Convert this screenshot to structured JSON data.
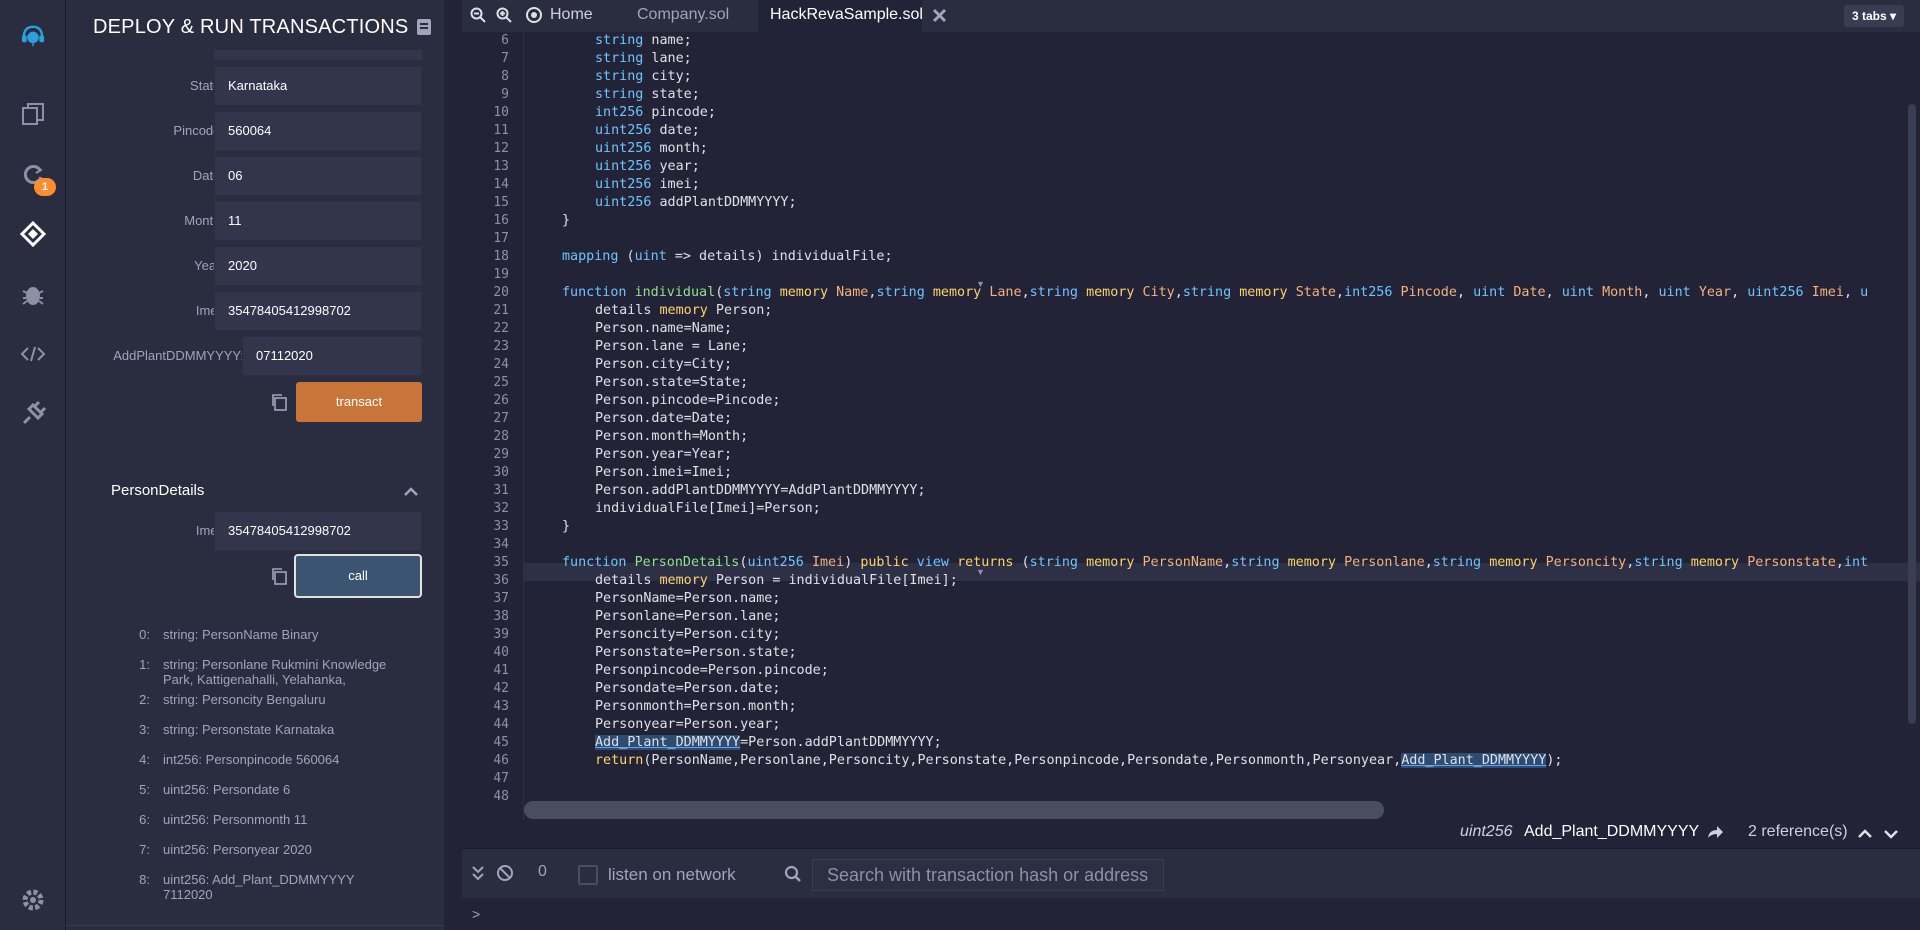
{
  "panel": {
    "title": "DEPLOY & RUN TRANSACTIONS",
    "fields": [
      {
        "label": "State:",
        "value": "Karnataka"
      },
      {
        "label": "Pincode:",
        "value": "560064"
      },
      {
        "label": "Date:",
        "value": "06"
      },
      {
        "label": "Month:",
        "value": "11"
      },
      {
        "label": "Year:",
        "value": "2020"
      },
      {
        "label": "Imei:",
        "value": "35478405412998702"
      },
      {
        "label": "AddPlantDDMMYYYY:",
        "value": "07112020"
      }
    ],
    "transact_label": "transact",
    "function_title": "PersonDetails",
    "call_field": {
      "label": "Imei:",
      "value": "35478405412998702"
    },
    "call_label": "call",
    "outputs": [
      {
        "idx": "0:",
        "val": "string: PersonName Binary"
      },
      {
        "idx": "1:",
        "val": "string: Personlane Rukmini Knowledge Park, Kattigenahalli, Yelahanka,"
      },
      {
        "idx": "2:",
        "val": "string: Personcity Bengaluru"
      },
      {
        "idx": "3:",
        "val": "string: Personstate Karnataka"
      },
      {
        "idx": "4:",
        "val": "int256: Personpincode 560064"
      },
      {
        "idx": "5:",
        "val": "uint256: Persondate 6"
      },
      {
        "idx": "6:",
        "val": "uint256: Personmonth 11"
      },
      {
        "idx": "7:",
        "val": "uint256: Personyear 2020"
      },
      {
        "idx": "8:",
        "val": "uint256: Add_Plant_DDMMYYYY 7112020"
      }
    ],
    "plugin_badge": "1"
  },
  "editor": {
    "tabs": {
      "home": "Home",
      "company": "Company.sol",
      "active": "HackRevaSample.sol",
      "count": "3 tabs"
    },
    "line_numbers": [
      "6",
      "7",
      "8",
      "9",
      "10",
      "11",
      "12",
      "13",
      "14",
      "15",
      "16",
      "17",
      "18",
      "19",
      "20",
      "21",
      "22",
      "23",
      "24",
      "25",
      "26",
      "27",
      "28",
      "29",
      "30",
      "31",
      "32",
      "33",
      "34",
      "35",
      "36",
      "37",
      "38",
      "39",
      "40",
      "41",
      "42",
      "43",
      "44",
      "45",
      "46",
      "47",
      "48"
    ],
    "ref_type": "uint256",
    "ref_name": "Add_Plant_DDMMYYYY",
    "ref_count": "2 reference(s)"
  },
  "terminal": {
    "count": "0",
    "listen_label": "listen on network",
    "search_placeholder": "Search with transaction hash or address",
    "prompt": ">"
  },
  "colors": {
    "accent_orange": "#c97539",
    "call_blue": "#3b5472",
    "keyword_blue": "#6ec4ff",
    "keyword_yellow": "#ffd36a",
    "function_green": "#8de38a",
    "identifier_orange": "#f4b27c"
  },
  "icons": [
    "remix-logo-icon",
    "file-explorer-icon",
    "compiler-icon",
    "deploy-icon",
    "debugger-icon",
    "remixd-icon",
    "plugin-manager-icon",
    "settings-icon",
    "docs-icon",
    "copy-icon",
    "chevron-up-icon",
    "zoom-out-icon",
    "zoom-in-icon",
    "home-icon",
    "close-icon",
    "share-icon",
    "chevron-down-icon",
    "clear-icon",
    "search-icon"
  ]
}
